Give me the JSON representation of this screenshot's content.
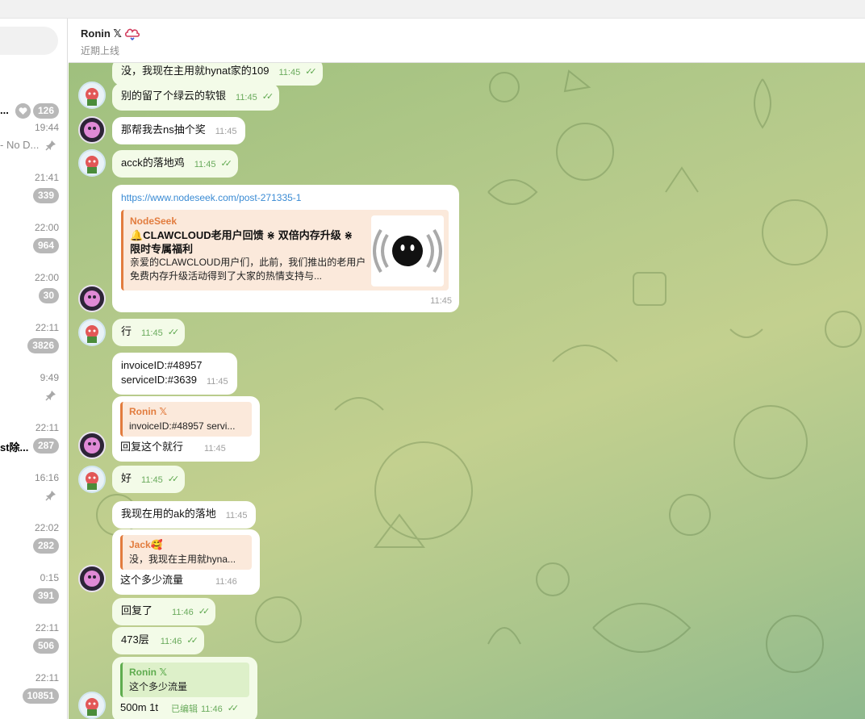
{
  "sidebar": {
    "items": [
      {
        "time": "",
        "snippet": "...",
        "badge": "126",
        "pin": false,
        "muted": true,
        "dark": true
      },
      {
        "time": "19:44",
        "snippet": "- No D...",
        "badge": "",
        "pin": true,
        "muted": false,
        "dark": false
      },
      {
        "time": "21:41",
        "snippet": "",
        "badge": "339",
        "pin": false,
        "muted": false,
        "dark": false
      },
      {
        "time": "22:00",
        "snippet": "",
        "badge": "964",
        "pin": false,
        "muted": false,
        "dark": false
      },
      {
        "time": "22:00",
        "snippet": "",
        "badge": "30",
        "pin": false,
        "muted": false,
        "dark": false
      },
      {
        "time": "22:11",
        "snippet": "",
        "badge": "3826",
        "pin": false,
        "muted": false,
        "dark": false
      },
      {
        "time": "9:49",
        "snippet": "",
        "badge": "",
        "pin": true,
        "muted": false,
        "dark": false
      },
      {
        "time": "22:11",
        "snippet": "st除...",
        "badge": "287",
        "pin": false,
        "muted": false,
        "dark": true
      },
      {
        "time": "16:16",
        "snippet": "",
        "badge": "",
        "pin": true,
        "muted": false,
        "dark": false
      },
      {
        "time": "22:02",
        "snippet": "",
        "badge": "282",
        "pin": false,
        "muted": false,
        "dark": false
      },
      {
        "time": "0:15",
        "snippet": "",
        "badge": "391",
        "pin": false,
        "muted": false,
        "dark": false
      },
      {
        "time": "22:11",
        "snippet": "",
        "badge": "506",
        "pin": false,
        "muted": false,
        "dark": false
      },
      {
        "time": "22:11",
        "snippet": "",
        "badge": "10851",
        "pin": false,
        "muted": false,
        "dark": false
      }
    ]
  },
  "header": {
    "name": "Ronin 𝕏",
    "status": "近期上线"
  },
  "messages": {
    "m0": {
      "text": "没，我现在主用就hynat家的109",
      "time": "11:45"
    },
    "m1": {
      "text": "别的留了个绿云的软银",
      "time": "11:45"
    },
    "m2": {
      "text": "那帮我去ns抽个奖",
      "time": "11:45"
    },
    "m3": {
      "text": "acck的落地鸡",
      "time": "11:45"
    },
    "m4": {
      "link": "https://www.nodeseek.com/post-271335-1",
      "site": "NodeSeek",
      "title": "🔔CLAWCLOUD老用户回馈 ⋇ 双倍内存升级 ⋇ 限时专属福利",
      "desc": "亲爱的CLAWCLOUD用户们，此前，我们推出的老用户免费内存升级活动得到了大家的热情支持与...",
      "time": "11:45"
    },
    "m5": {
      "text": "行",
      "time": "11:45"
    },
    "m6": {
      "line1": "invoiceID:#48957",
      "line2": "serviceID:#3639",
      "time": "11:45"
    },
    "m7": {
      "reply_name": "Ronin 𝕏",
      "reply_text": "invoiceID:#48957 servi...",
      "text": "回复这个就行",
      "time": "11:45"
    },
    "m8": {
      "text": "好",
      "time": "11:45"
    },
    "m9": {
      "text": "我现在用的ak的落地",
      "time": "11:45"
    },
    "m10": {
      "reply_name": "Jack🥰",
      "reply_text": "没，我现在主用就hyna...",
      "text": "这个多少流量",
      "time": "11:46"
    },
    "m11": {
      "text": "回复了",
      "time": "11:46"
    },
    "m12": {
      "text": "473层",
      "time": "11:46"
    },
    "m13": {
      "reply_name": "Ronin 𝕏",
      "reply_text": "这个多少流量",
      "text": "500m 1t",
      "edited": "已编辑",
      "time": "11:46"
    }
  },
  "colors": {
    "outgoing_bubble": "#f3fbe8",
    "incoming_bubble": "#ffffff",
    "accent_orange": "#e27c3e",
    "accent_green": "#5fac4f",
    "link": "#3a8bd4",
    "badge": "#b8b8b8"
  },
  "icons": {
    "pin": "pin-icon",
    "mute": "heart-mute-icon",
    "read_ticks": "double-check-icon",
    "header_emoji": "cloud-heart-icon"
  }
}
